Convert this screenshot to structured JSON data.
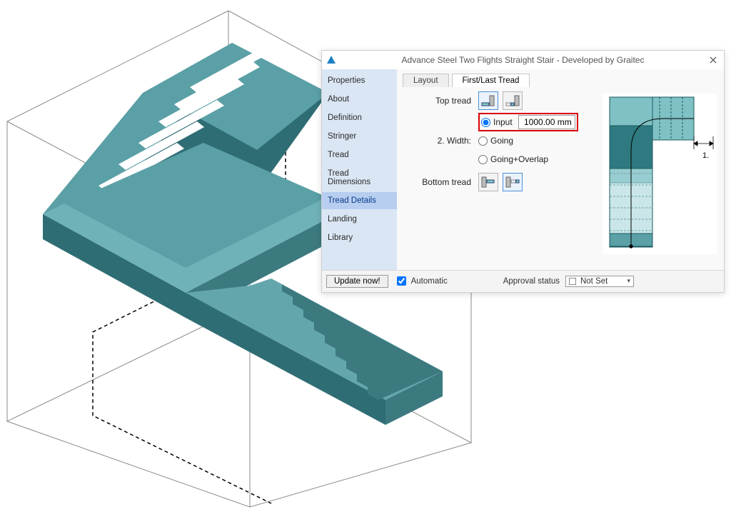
{
  "dialog": {
    "title": "Advance Steel   Two Flights Straight Stair - Developed by Graitec",
    "sidebar": {
      "items": [
        "Properties",
        "About",
        "Definition",
        "Stringer",
        "Tread",
        "Tread Dimensions",
        "Tread Details",
        "Landing",
        "Library"
      ],
      "selected_index": 6
    },
    "tabs": {
      "items": [
        "Layout",
        "First/Last Tread"
      ],
      "active_index": 1
    },
    "labels": {
      "top_tread": "Top tread",
      "width_prefix": "2. Width:",
      "input": "Input",
      "going": "Going",
      "going_overlap": "Going+Overlap",
      "bottom_tread": "Bottom tread",
      "diagram_dim": "1."
    },
    "input_value": "1000.00 mm",
    "width_radios": {
      "selected": "Input"
    },
    "bottom": {
      "update_btn": "Update now!",
      "automatic_label": "Automatic",
      "automatic_checked": true,
      "approval_label": "Approval status",
      "approval_value": "Not Set"
    }
  }
}
